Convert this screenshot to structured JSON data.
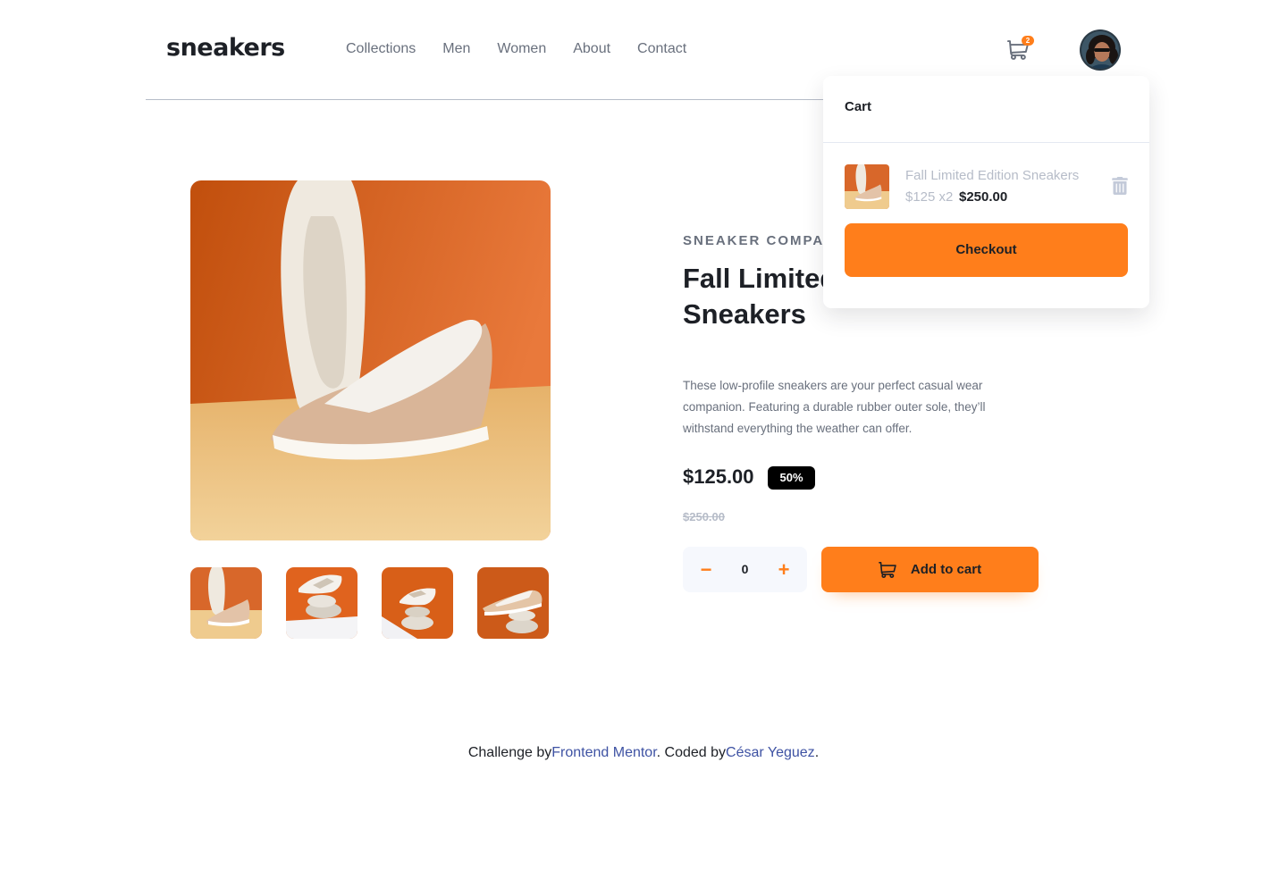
{
  "header": {
    "logo": "sneakers",
    "nav": [
      "Collections",
      "Men",
      "Women",
      "About",
      "Contact"
    ],
    "cart_count": "2"
  },
  "product": {
    "company": "SNEAKER COMPANY",
    "title": "Fall Limited Edition Sneakers",
    "description": "These low-profile sneakers are your perfect casual wear companion. Featuring a durable rubber outer sole, they’ll withstand everything the weather can offer.",
    "price": "$125.00",
    "discount": "50%",
    "old_price": "$250.00",
    "quantity": "0",
    "minus_label": "−",
    "plus_label": "+",
    "add_to_cart_label": "Add to cart"
  },
  "cart": {
    "heading": "Cart",
    "item_name": "Fall Limited Edition Sneakers",
    "item_unit": "$125 x2",
    "item_total": "$250.00",
    "checkout_label": "Checkout"
  },
  "footer": {
    "prefix": "Challenge by",
    "link1": "Frontend Mentor",
    "middle": ". Coded by",
    "link2": "César Yeguez",
    "suffix": "."
  },
  "colors": {
    "accent": "#ff7e1b",
    "dark": "#1d2026",
    "grey": "#69707d",
    "light_grey": "#b6bcc8",
    "link": "#3e52a3"
  }
}
